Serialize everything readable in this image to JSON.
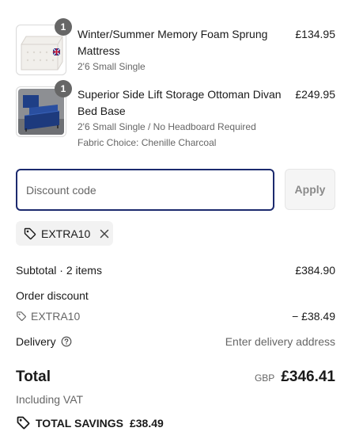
{
  "items": [
    {
      "quantity": "1",
      "title": "Winter/Summer Memory Foam Sprung Mattress",
      "variant_lines": [
        "2'6 Small Single"
      ],
      "price": "£134.95"
    },
    {
      "quantity": "1",
      "title": "Superior Side Lift Storage Ottoman Divan Bed Base",
      "variant_lines": [
        "2'6 Small Single / No Headboard Required",
        "Fabric Choice: Chenille Charcoal"
      ],
      "price": "£249.95"
    }
  ],
  "discount": {
    "placeholder": "Discount code",
    "value": "",
    "apply_label": "Apply",
    "applied_code": "EXTRA10"
  },
  "summary": {
    "subtotal_label": "Subtotal · 2 items",
    "subtotal_value": "£384.90",
    "order_discount_label": "Order discount",
    "discount_code": "EXTRA10",
    "discount_value": "− £38.49",
    "delivery_label": "Delivery",
    "delivery_value": "Enter delivery address",
    "total_label": "Total",
    "currency": "GBP",
    "total_value": "£346.41",
    "vat_note": "Including VAT",
    "savings_label": "TOTAL SAVINGS",
    "savings_value": "£38.49"
  },
  "colors": {
    "focus_border": "#1c2a6e",
    "badge": "#666666",
    "muted_text": "#666666"
  },
  "icons": [
    "tag-icon",
    "close-icon",
    "help-circle-icon",
    "savings-tag-icon"
  ]
}
